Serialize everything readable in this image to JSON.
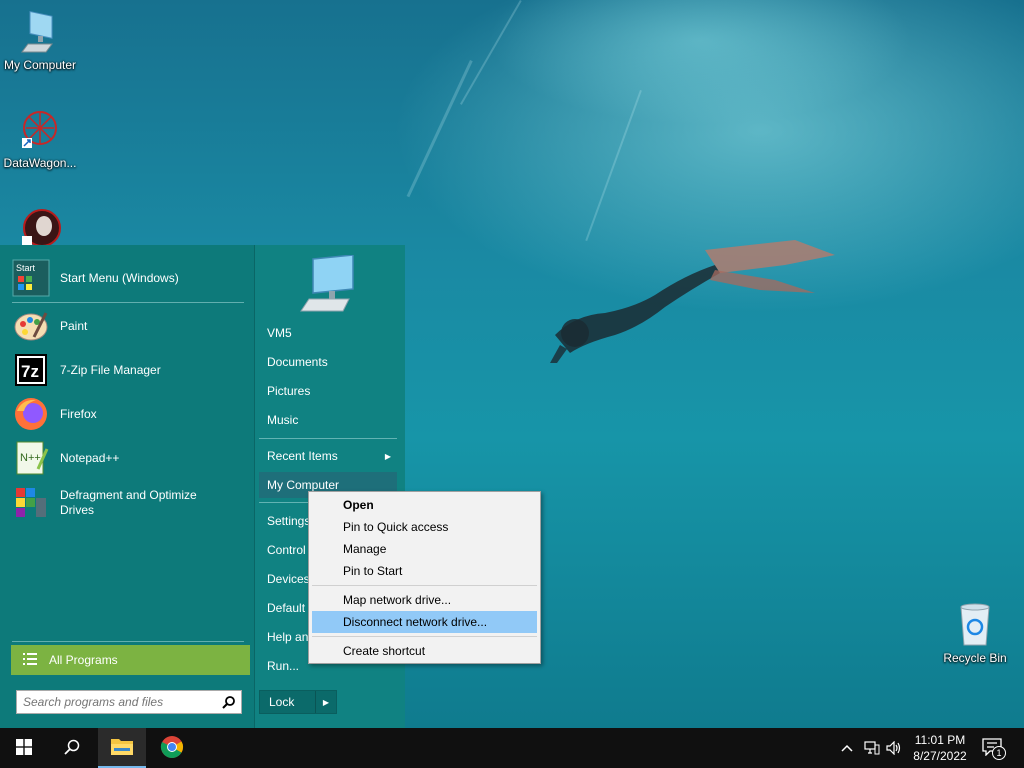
{
  "desktop": {
    "icons": [
      {
        "label": "My Computer",
        "icon": "monitor-icon"
      },
      {
        "label": "DataWagon...",
        "icon": "datawagon-icon"
      },
      {
        "label": "",
        "icon": "avatar-icon"
      },
      {
        "label": "Recycle Bin",
        "icon": "recycle-bin-icon"
      }
    ]
  },
  "start_menu": {
    "header_item": {
      "label": "Start Menu (Windows)",
      "icon": "start-menu-icon"
    },
    "programs": [
      {
        "label": "Paint",
        "icon": "paint-icon"
      },
      {
        "label": "7-Zip File Manager",
        "icon": "7zip-icon"
      },
      {
        "label": "Firefox",
        "icon": "firefox-icon"
      },
      {
        "label": "Notepad++",
        "icon": "notepadpp-icon"
      },
      {
        "label": "Defragment and Optimize Drives",
        "icon": "defrag-icon"
      }
    ],
    "all_programs": "All Programs",
    "search_placeholder": "Search programs and files",
    "right_pane": {
      "items": [
        "VM5",
        "Documents",
        "Pictures",
        "Music",
        "Recent Items",
        "My Computer",
        "Settings",
        "Control",
        "Devices",
        "Default",
        "Help an",
        "Run..."
      ],
      "lock": "Lock"
    }
  },
  "context_menu": {
    "items": [
      "Open",
      "Pin to Quick access",
      "Manage",
      "Pin to Start",
      "Map network drive...",
      "Disconnect network drive...",
      "Create shortcut"
    ],
    "highlighted": "Disconnect network drive..."
  },
  "taskbar": {
    "time": "11:01 PM",
    "date": "8/27/2022",
    "notification_count": "1"
  }
}
